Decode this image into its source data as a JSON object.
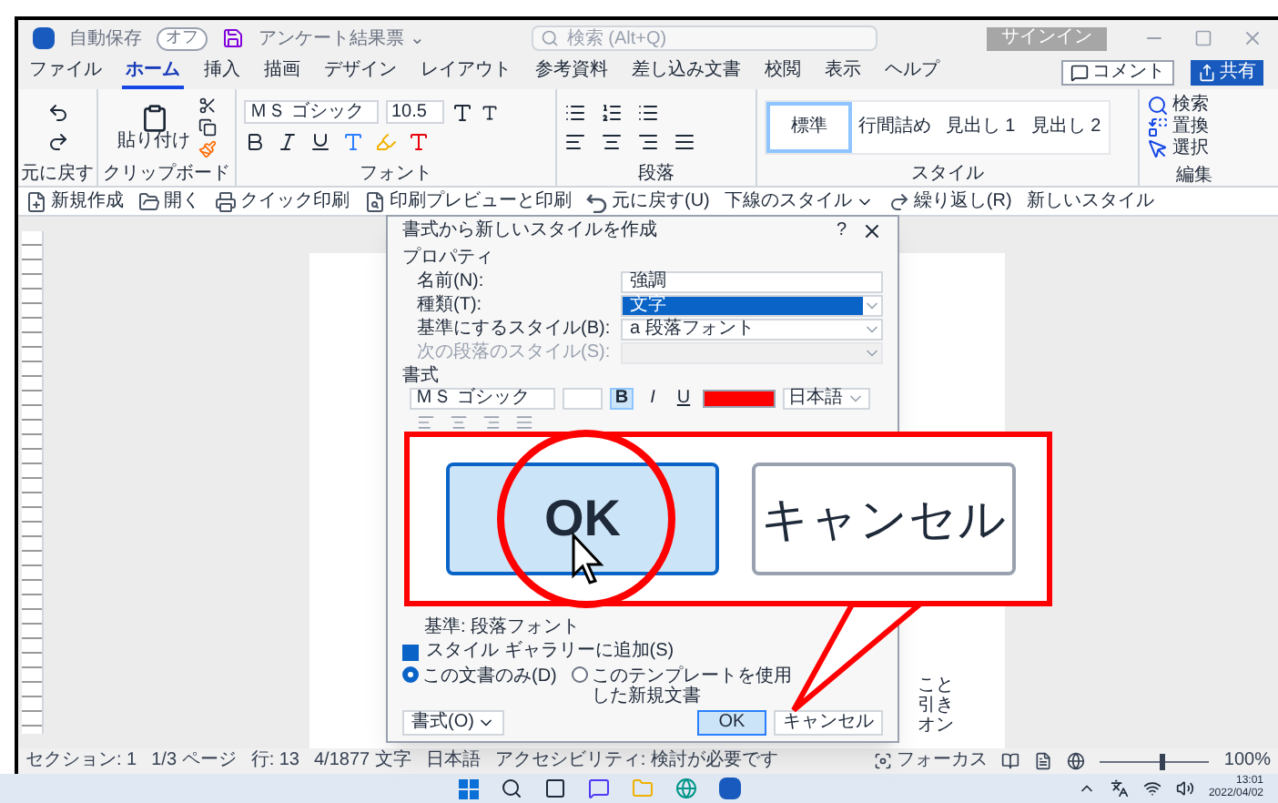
{
  "title_bar": {
    "autosave_label": "自動保存",
    "autosave_on": false,
    "autosave_state": "オフ",
    "document_title": "アンケート結果票 ⌄",
    "search_placeholder": "検索 (Alt+Q)",
    "sign_in": "サインイン"
  },
  "menu_tabs": [
    {
      "label": "ファイル",
      "selected": false
    },
    {
      "label": "ホーム",
      "selected": true
    },
    {
      "label": "挿入",
      "selected": false
    },
    {
      "label": "描画",
      "selected": false
    },
    {
      "label": "デザイン",
      "selected": false
    },
    {
      "label": "レイアウト",
      "selected": false
    },
    {
      "label": "参考資料",
      "selected": false
    },
    {
      "label": "差し込み文書",
      "selected": false
    },
    {
      "label": "校閲",
      "selected": false
    },
    {
      "label": "表示",
      "selected": false
    },
    {
      "label": "ヘルプ",
      "selected": false
    }
  ],
  "comment_button": "コメント",
  "share_button": "共有",
  "ribbon": {
    "undo_label": "元に戻す",
    "paste": "貼り付け",
    "clipboard_label": "クリップボード",
    "font_name": "ＭＳ ゴシック",
    "font_size": "10.5",
    "font_label": "フォント",
    "paragraph_label": "段落",
    "styles": [
      {
        "label": "標準",
        "selected": true
      },
      {
        "label": "行間詰め",
        "selected": false
      },
      {
        "label": "見出し 1",
        "selected": false
      },
      {
        "label": "見出し 2",
        "selected": false
      }
    ],
    "styles_label": "スタイル",
    "editing": [
      {
        "label": "検索",
        "kind": "find"
      },
      {
        "label": "置換",
        "kind": "replace"
      },
      {
        "label": "選択",
        "kind": "select"
      }
    ],
    "editing_label": "編集"
  },
  "quick_access": [
    {
      "label": "新規作成",
      "kind": "new"
    },
    {
      "label": "開く",
      "kind": "open"
    },
    {
      "label": "クイック印刷",
      "kind": "print"
    },
    {
      "label": "印刷プレビューと印刷",
      "kind": "preview"
    },
    {
      "label": "元に戻す(U)",
      "kind": "undo"
    },
    {
      "label": "下線のスタイル",
      "kind": "dropdown"
    },
    {
      "label": "繰り返し(R)",
      "kind": "redo"
    },
    {
      "label": "新しいスタイル",
      "kind": "plain"
    }
  ],
  "dialog": {
    "title": "書式から新しいスタイルを作成",
    "help": "?",
    "properties_label": "プロパティ",
    "fields": [
      {
        "label": "名前(N):",
        "value": "強調",
        "kind": "text",
        "selected": false,
        "disabled": false
      },
      {
        "label": "種類(T):",
        "value": "文字",
        "kind": "select",
        "selected": true,
        "disabled": false
      },
      {
        "label": "基準にするスタイル(B):",
        "value": "a 段落フォント",
        "kind": "select",
        "selected": false,
        "disabled": false
      },
      {
        "label": "次の段落のスタイル(S):",
        "kind": "select",
        "selected": false,
        "disabled": true
      }
    ],
    "format_label": "書式",
    "font": "ＭＳ ゴシック",
    "format_buttons": [
      {
        "label": "B",
        "kind": "bold",
        "on": true
      },
      {
        "label": "I",
        "kind": "italic",
        "on": false
      },
      {
        "label": "U",
        "kind": "underline",
        "on": false
      }
    ],
    "language": "日本語",
    "description": "基準: 段落フォント",
    "add_to_gallery": {
      "label": "スタイル ギャラリーに追加(S)",
      "checked": true
    },
    "scope": [
      {
        "label": "この文書のみ(D)",
        "selected": true
      },
      {
        "label": "このテンプレートを使用した新規文書",
        "selected": false
      }
    ],
    "format_button": "書式(O)",
    "ok": "OK",
    "cancel": "キャンセル"
  },
  "page_fragments": [
    "こと",
    "引き",
    "オン"
  ],
  "callout": {
    "ok": "OK",
    "cancel": "キャンセル"
  },
  "status_bar": {
    "items": [
      "セクション: 1",
      "1/3 ページ",
      "行: 13",
      "4/1877 文字",
      "日本語",
      "アクセシビリティ: 検討が必要です"
    ],
    "focus": "フォーカス",
    "zoom_slider": {
      "level": 0.55
    },
    "zoom": "100%"
  },
  "taskbar": {
    "time": "13:01",
    "date": "2022/04/02"
  }
}
